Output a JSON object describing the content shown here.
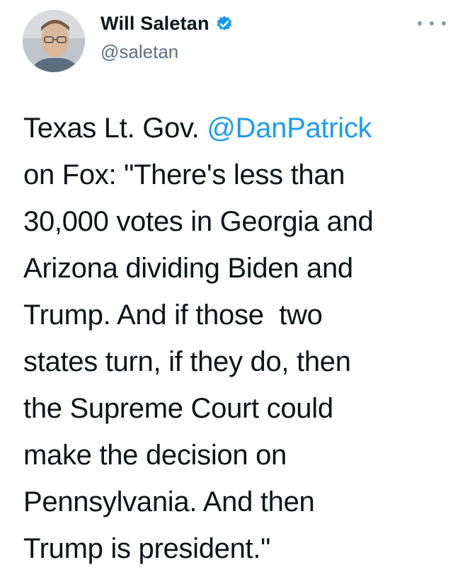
{
  "author": {
    "name": "Will Saletan",
    "handle": "@saletan",
    "verified": true,
    "avatar_icon": "profile-photo"
  },
  "header": {
    "more_icon": "more-options-icon"
  },
  "tweet": {
    "part1": "Texas Lt. Gov. ",
    "mention": "@DanPatrick",
    "part2": "\non Fox: \"There's less than\n30,000 votes in Georgia and\nArizona dividing Biden and\nTrump. And if those  two\nstates turn, if they do, then\nthe Supreme Court could\nmake the decision on\nPennsylvania. And then\nTrump is president.\""
  },
  "colors": {
    "link": "#1d9bf0",
    "verified_badge": "#1d9bf0",
    "secondary_text": "#5b7083"
  }
}
